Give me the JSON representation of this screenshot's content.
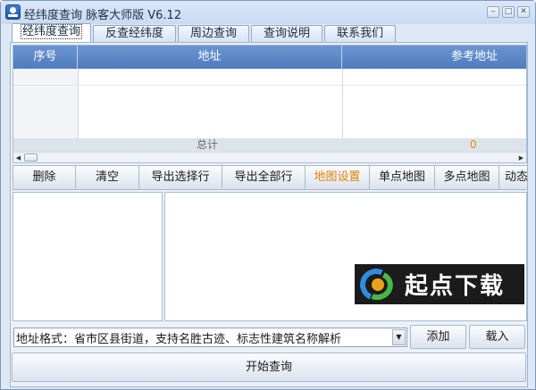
{
  "window": {
    "title": "经纬度查询 脉客大师版 V6.12",
    "controls": {
      "minimize": "‒",
      "maximize": "□",
      "close": "✕"
    }
  },
  "tabs": [
    {
      "label": "经纬度查询",
      "active": true
    },
    {
      "label": "反查经纬度",
      "active": false
    },
    {
      "label": "周边查询",
      "active": false
    },
    {
      "label": "查询说明",
      "active": false
    },
    {
      "label": "联系我们",
      "active": false
    }
  ],
  "grid": {
    "columns": [
      "序号",
      "地址",
      "参考地址"
    ],
    "rows": [],
    "total_label": "总计",
    "total_value": "0"
  },
  "toolbar": {
    "buttons": [
      "删除",
      "清空",
      "导出选择行",
      "导出全部行",
      "地图设置",
      "单点地图",
      "多点地图",
      "动态"
    ],
    "accent_button": "地图设置",
    "accent_color": "#e1830d"
  },
  "watermark": {
    "text": "起点下载"
  },
  "address": {
    "value": "地址格式：省市区县街道，支持名胜古迹、标志性建筑名称解析"
  },
  "actions": {
    "add": "添加",
    "load": "载入",
    "start": "开始查询"
  },
  "colors": {
    "header_blue": "#5a87c8",
    "window_bg": "#dfe8f5",
    "total_value": "#e78a16"
  }
}
